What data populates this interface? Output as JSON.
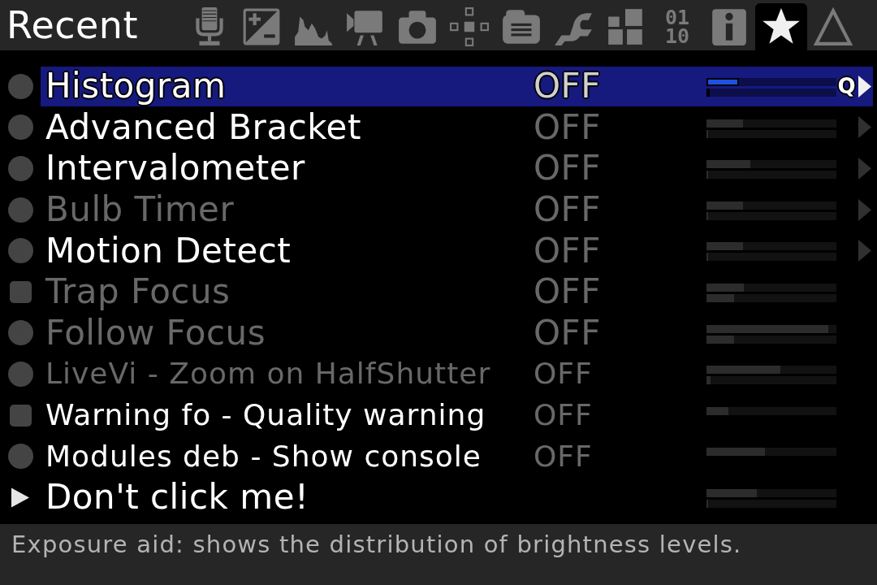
{
  "header": {
    "title": "Recent",
    "tabs": [
      {
        "kind": "microphone",
        "selected": false
      },
      {
        "kind": "exposure",
        "selected": false
      },
      {
        "kind": "histogram",
        "selected": false
      },
      {
        "kind": "video",
        "selected": false
      },
      {
        "kind": "camera",
        "selected": false
      },
      {
        "kind": "focus-points",
        "selected": false
      },
      {
        "kind": "clipboard",
        "selected": false
      },
      {
        "kind": "wrench",
        "selected": false
      },
      {
        "kind": "blocks",
        "selected": false
      },
      {
        "kind": "digits",
        "lines": [
          "01",
          "10"
        ],
        "selected": false
      },
      {
        "kind": "info",
        "selected": false
      },
      {
        "kind": "star",
        "selected": true
      },
      {
        "kind": "triangle",
        "selected": false
      }
    ]
  },
  "menu": {
    "items": [
      {
        "name": "Histogram",
        "value": "OFF",
        "kind": "circle",
        "dimmed": false,
        "selected": true,
        "submenu": true,
        "shortcut": "Q",
        "meters": [
          {
            "level": 0.25
          },
          {
            "level": 0.02
          }
        ]
      },
      {
        "name": "Advanced Bracket",
        "value": "OFF",
        "kind": "circle",
        "dimmed": false,
        "selected": false,
        "submenu": true,
        "meters": [
          {
            "level": 0.28
          },
          {
            "level": 0.01
          }
        ]
      },
      {
        "name": "Intervalometer",
        "value": "OFF",
        "kind": "circle",
        "dimmed": false,
        "selected": false,
        "submenu": true,
        "meters": [
          {
            "level": 0.34
          },
          {
            "level": 0.01
          }
        ]
      },
      {
        "name": "Bulb Timer",
        "value": "OFF",
        "kind": "circle",
        "dimmed": true,
        "selected": false,
        "submenu": true,
        "meters": [
          {
            "level": 0.28
          },
          {
            "level": 0.01
          }
        ]
      },
      {
        "name": "Motion Detect",
        "value": "OFF",
        "kind": "circle",
        "dimmed": false,
        "selected": false,
        "submenu": true,
        "meters": [
          {
            "level": 0.28
          },
          {
            "level": 0.01
          }
        ]
      },
      {
        "name": "Trap Focus",
        "value": "OFF",
        "kind": "square",
        "dimmed": true,
        "selected": false,
        "submenu": false,
        "meters": [
          {
            "level": 0.29
          },
          {
            "level": 0.21
          }
        ]
      },
      {
        "name": "Follow Focus",
        "value": "OFF",
        "kind": "circle",
        "dimmed": true,
        "selected": false,
        "submenu": false,
        "meters": [
          {
            "level": 0.94
          },
          {
            "level": 0.21
          }
        ]
      },
      {
        "name": "LiveVi - Zoom on HalfShutter",
        "value": "OFF",
        "kind": "circle",
        "dimmed": true,
        "selected": false,
        "submenu": false,
        "meters": [
          {
            "level": 0.57
          },
          {
            "level": 0.03
          }
        ]
      },
      {
        "name": "Warning fo - Quality warning",
        "value": "OFF",
        "kind": "square",
        "dimmed": false,
        "selected": false,
        "submenu": false,
        "meters": [
          {
            "level": 0.17
          }
        ]
      },
      {
        "name": "Modules deb - Show console",
        "value": "OFF",
        "kind": "circle",
        "dimmed": false,
        "selected": false,
        "submenu": false,
        "meters": [
          {
            "level": 0.45
          }
        ]
      },
      {
        "name": "Don't click me!",
        "kind": "action",
        "dimmed": false,
        "selected": false,
        "submenu": false,
        "meters": [
          {
            "level": 0.39
          },
          {
            "level": 0.01
          }
        ]
      }
    ]
  },
  "help_text": "Exposure aid: shows the distribution of brightness levels."
}
